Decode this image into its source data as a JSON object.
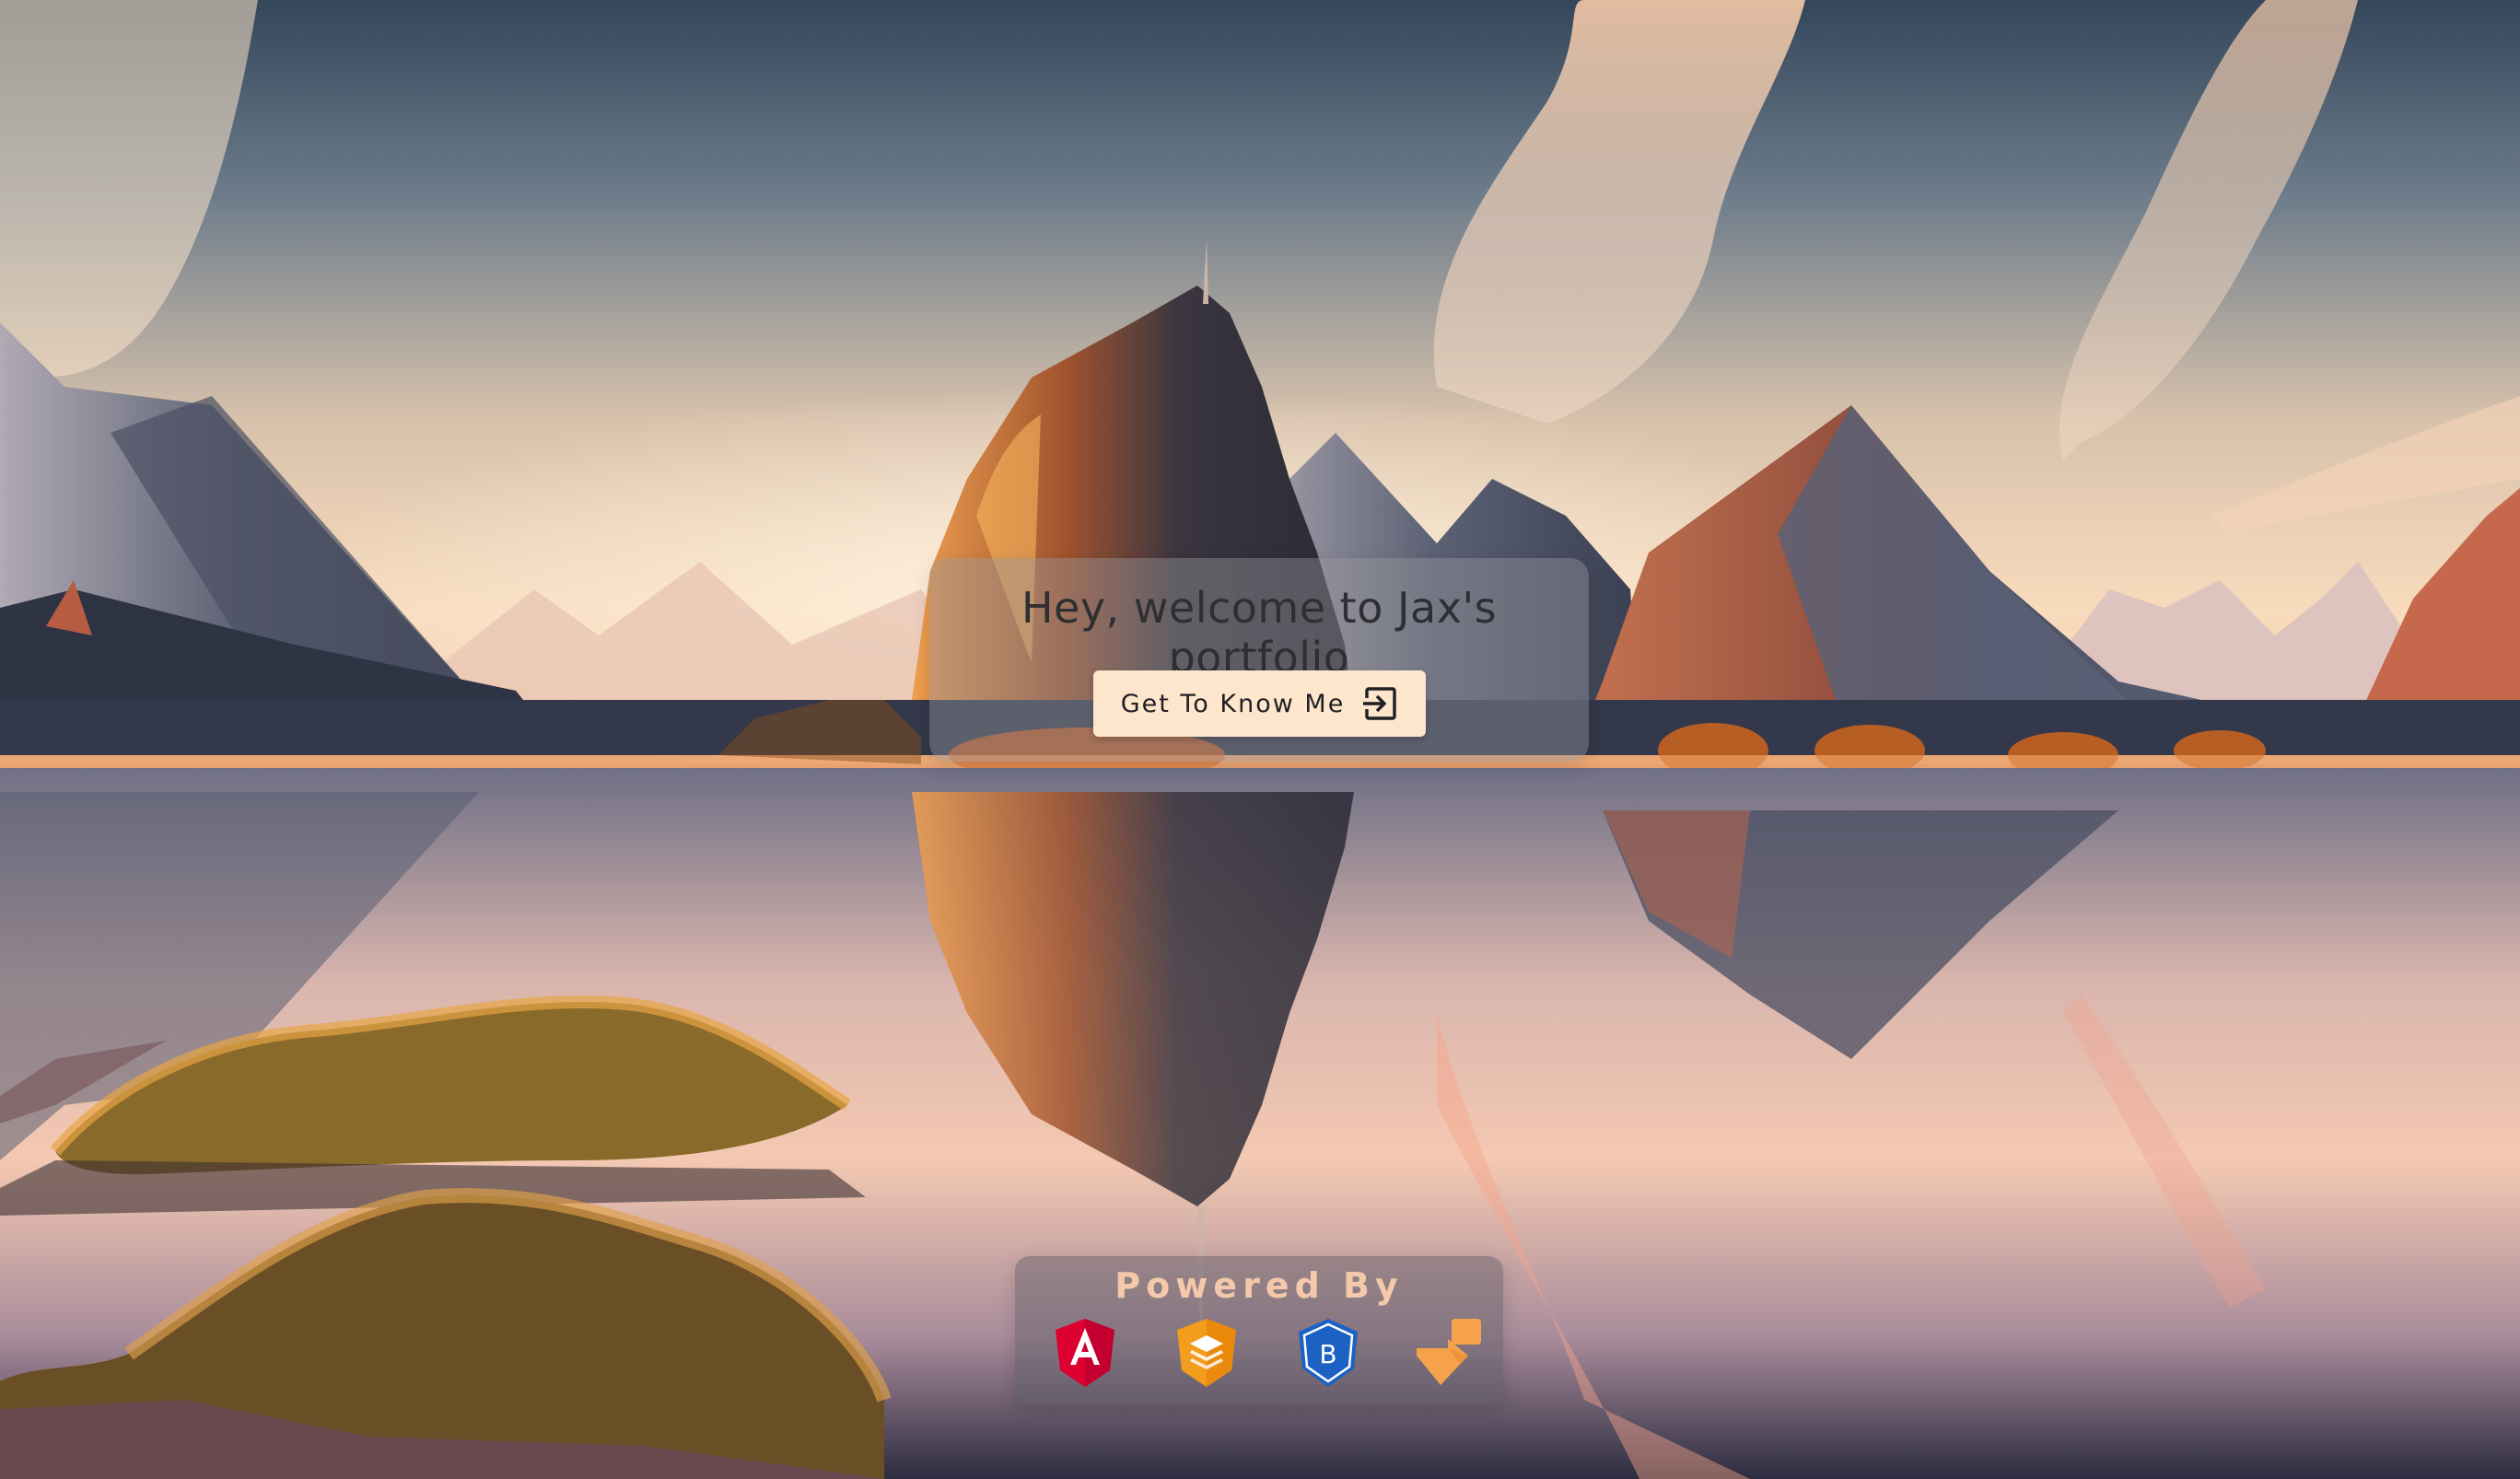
{
  "hero": {
    "title": "Hey, welcome to Jax's portfolio",
    "cta_label": "Get To Know Me",
    "cta_icon": "login-icon"
  },
  "powered_by": {
    "title": "Powered By",
    "logos": [
      {
        "name": "angular-logo",
        "color": "#dd0031"
      },
      {
        "name": "stack-layers-logo",
        "color": "#f29d1d"
      },
      {
        "name": "bootstrap-logo",
        "color": "#1b62c4"
      },
      {
        "name": "block-shapes-logo",
        "color": "#f6a24d"
      }
    ]
  },
  "colors": {
    "card_background": "rgba(150,150,155,0.42)",
    "button_background": "#fde6cc",
    "powered_title": "#f4c8aa"
  }
}
